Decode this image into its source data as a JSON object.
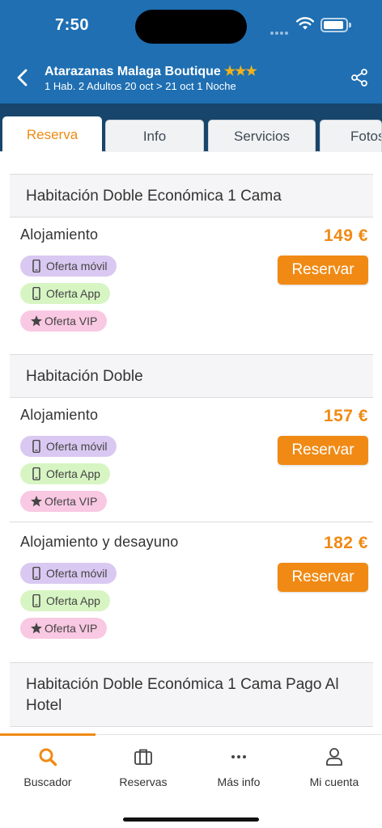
{
  "status": {
    "time": "7:50"
  },
  "header": {
    "hotel_name": "Atarazanas Malaga Boutique",
    "stars": "★★★",
    "subtitle": "1 Hab. 2 Adultos 20 oct > 21 oct 1 Noche"
  },
  "tabs": [
    {
      "label": "Reserva",
      "active": true
    },
    {
      "label": "Info"
    },
    {
      "label": "Servicios"
    },
    {
      "label": "Fotos"
    }
  ],
  "rooms": [
    {
      "name": "Habitación Doble Económica 1 Cama",
      "rates": [
        {
          "name": "Alojamiento",
          "price": "149 €",
          "button": "Reservar"
        }
      ]
    },
    {
      "name": "Habitación Doble",
      "rates": [
        {
          "name": "Alojamiento",
          "price": "157 €",
          "button": "Reservar"
        },
        {
          "name": "Alojamiento y desayuno",
          "price": "182 €",
          "button": "Reservar"
        }
      ]
    },
    {
      "name": "Habitación Doble Económica 1 Cama Pago Al Hotel"
    }
  ],
  "badges": {
    "movil": "Oferta móvil",
    "app": "Oferta App",
    "vip": "Oferta VIP"
  },
  "bottom_nav": [
    {
      "label": "Buscador",
      "icon": "search-icon",
      "active": true
    },
    {
      "label": "Reservas",
      "icon": "briefcase-icon"
    },
    {
      "label": "Más info",
      "icon": "more-icon"
    },
    {
      "label": "Mi cuenta",
      "icon": "user-icon"
    }
  ],
  "colors": {
    "header": "#1f6fb2",
    "tabs_bar": "#17456b",
    "accent": "#f08a14"
  }
}
